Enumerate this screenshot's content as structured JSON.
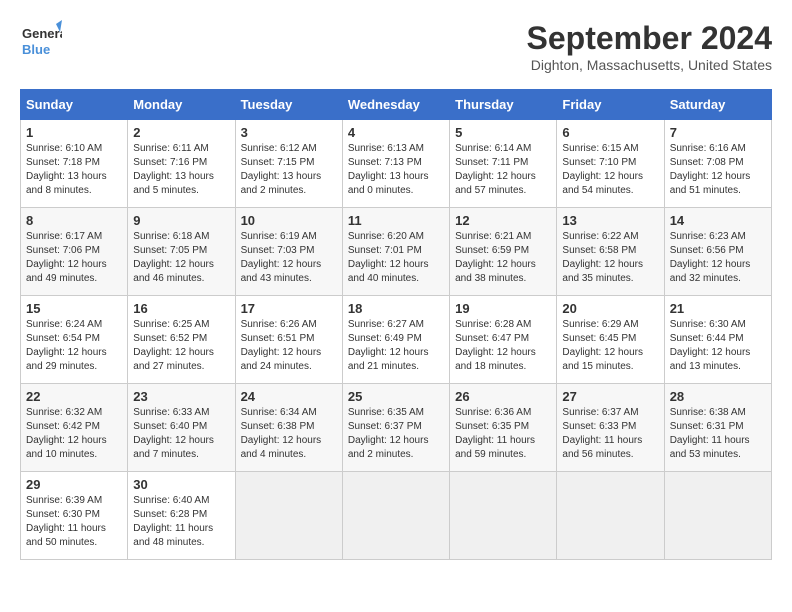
{
  "logo": {
    "line1": "General",
    "line2": "Blue"
  },
  "title": "September 2024",
  "location": "Dighton, Massachusetts, United States",
  "headers": [
    "Sunday",
    "Monday",
    "Tuesday",
    "Wednesday",
    "Thursday",
    "Friday",
    "Saturday"
  ],
  "weeks": [
    [
      {
        "day": "1",
        "info": "Sunrise: 6:10 AM\nSunset: 7:18 PM\nDaylight: 13 hours\nand 8 minutes."
      },
      {
        "day": "2",
        "info": "Sunrise: 6:11 AM\nSunset: 7:16 PM\nDaylight: 13 hours\nand 5 minutes."
      },
      {
        "day": "3",
        "info": "Sunrise: 6:12 AM\nSunset: 7:15 PM\nDaylight: 13 hours\nand 2 minutes."
      },
      {
        "day": "4",
        "info": "Sunrise: 6:13 AM\nSunset: 7:13 PM\nDaylight: 13 hours\nand 0 minutes."
      },
      {
        "day": "5",
        "info": "Sunrise: 6:14 AM\nSunset: 7:11 PM\nDaylight: 12 hours\nand 57 minutes."
      },
      {
        "day": "6",
        "info": "Sunrise: 6:15 AM\nSunset: 7:10 PM\nDaylight: 12 hours\nand 54 minutes."
      },
      {
        "day": "7",
        "info": "Sunrise: 6:16 AM\nSunset: 7:08 PM\nDaylight: 12 hours\nand 51 minutes."
      }
    ],
    [
      {
        "day": "8",
        "info": "Sunrise: 6:17 AM\nSunset: 7:06 PM\nDaylight: 12 hours\nand 49 minutes."
      },
      {
        "day": "9",
        "info": "Sunrise: 6:18 AM\nSunset: 7:05 PM\nDaylight: 12 hours\nand 46 minutes."
      },
      {
        "day": "10",
        "info": "Sunrise: 6:19 AM\nSunset: 7:03 PM\nDaylight: 12 hours\nand 43 minutes."
      },
      {
        "day": "11",
        "info": "Sunrise: 6:20 AM\nSunset: 7:01 PM\nDaylight: 12 hours\nand 40 minutes."
      },
      {
        "day": "12",
        "info": "Sunrise: 6:21 AM\nSunset: 6:59 PM\nDaylight: 12 hours\nand 38 minutes."
      },
      {
        "day": "13",
        "info": "Sunrise: 6:22 AM\nSunset: 6:58 PM\nDaylight: 12 hours\nand 35 minutes."
      },
      {
        "day": "14",
        "info": "Sunrise: 6:23 AM\nSunset: 6:56 PM\nDaylight: 12 hours\nand 32 minutes."
      }
    ],
    [
      {
        "day": "15",
        "info": "Sunrise: 6:24 AM\nSunset: 6:54 PM\nDaylight: 12 hours\nand 29 minutes."
      },
      {
        "day": "16",
        "info": "Sunrise: 6:25 AM\nSunset: 6:52 PM\nDaylight: 12 hours\nand 27 minutes."
      },
      {
        "day": "17",
        "info": "Sunrise: 6:26 AM\nSunset: 6:51 PM\nDaylight: 12 hours\nand 24 minutes."
      },
      {
        "day": "18",
        "info": "Sunrise: 6:27 AM\nSunset: 6:49 PM\nDaylight: 12 hours\nand 21 minutes."
      },
      {
        "day": "19",
        "info": "Sunrise: 6:28 AM\nSunset: 6:47 PM\nDaylight: 12 hours\nand 18 minutes."
      },
      {
        "day": "20",
        "info": "Sunrise: 6:29 AM\nSunset: 6:45 PM\nDaylight: 12 hours\nand 15 minutes."
      },
      {
        "day": "21",
        "info": "Sunrise: 6:30 AM\nSunset: 6:44 PM\nDaylight: 12 hours\nand 13 minutes."
      }
    ],
    [
      {
        "day": "22",
        "info": "Sunrise: 6:32 AM\nSunset: 6:42 PM\nDaylight: 12 hours\nand 10 minutes."
      },
      {
        "day": "23",
        "info": "Sunrise: 6:33 AM\nSunset: 6:40 PM\nDaylight: 12 hours\nand 7 minutes."
      },
      {
        "day": "24",
        "info": "Sunrise: 6:34 AM\nSunset: 6:38 PM\nDaylight: 12 hours\nand 4 minutes."
      },
      {
        "day": "25",
        "info": "Sunrise: 6:35 AM\nSunset: 6:37 PM\nDaylight: 12 hours\nand 2 minutes."
      },
      {
        "day": "26",
        "info": "Sunrise: 6:36 AM\nSunset: 6:35 PM\nDaylight: 11 hours\nand 59 minutes."
      },
      {
        "day": "27",
        "info": "Sunrise: 6:37 AM\nSunset: 6:33 PM\nDaylight: 11 hours\nand 56 minutes."
      },
      {
        "day": "28",
        "info": "Sunrise: 6:38 AM\nSunset: 6:31 PM\nDaylight: 11 hours\nand 53 minutes."
      }
    ],
    [
      {
        "day": "29",
        "info": "Sunrise: 6:39 AM\nSunset: 6:30 PM\nDaylight: 11 hours\nand 50 minutes."
      },
      {
        "day": "30",
        "info": "Sunrise: 6:40 AM\nSunset: 6:28 PM\nDaylight: 11 hours\nand 48 minutes."
      },
      null,
      null,
      null,
      null,
      null
    ]
  ]
}
